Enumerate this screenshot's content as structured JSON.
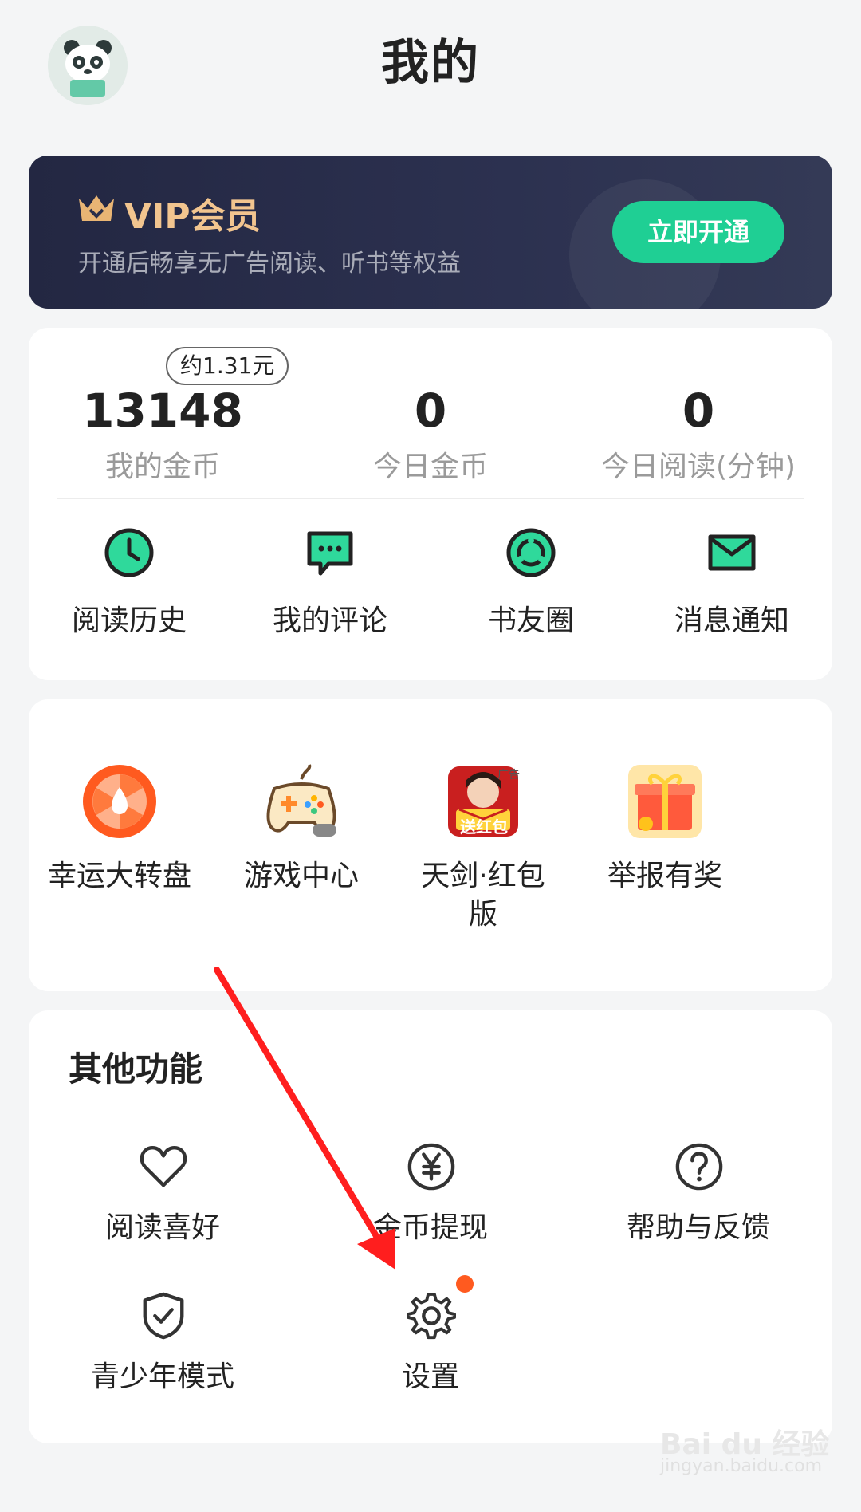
{
  "header": {
    "title": "我的"
  },
  "vip": {
    "title": "VIP会员",
    "description": "开通后畅享无广告阅读、听书等权益",
    "button": "立即开通"
  },
  "stats": [
    {
      "value": "13148",
      "label": "我的金币",
      "badge": "约1.31元"
    },
    {
      "value": "0",
      "label": "今日金币"
    },
    {
      "value": "0",
      "label": "今日阅读(分钟)"
    }
  ],
  "quick_actions": [
    {
      "label": "阅读历史",
      "icon": "clock-icon"
    },
    {
      "label": "我的评论",
      "icon": "comment-icon"
    },
    {
      "label": "书友圈",
      "icon": "circle-icon"
    },
    {
      "label": "消息通知",
      "icon": "mail-icon"
    }
  ],
  "promos": [
    {
      "label": "幸运大转盘",
      "icon": "lucky-wheel-icon"
    },
    {
      "label": "游戏中心",
      "icon": "gamepad-icon"
    },
    {
      "label_line1": "天剑·红包",
      "label_line2": "版",
      "icon": "game-ad-icon",
      "ad_tag": "广告",
      "ad_text": "送红包"
    },
    {
      "label": "举报有奖",
      "icon": "gift-icon"
    }
  ],
  "other": {
    "title": "其他功能",
    "items": [
      {
        "label": "阅读喜好",
        "icon": "heart-icon"
      },
      {
        "label": "金币提现",
        "icon": "yen-icon"
      },
      {
        "label": "帮助与反馈",
        "icon": "help-icon"
      },
      {
        "label": "青少年模式",
        "icon": "shield-check-icon"
      },
      {
        "label": "设置",
        "icon": "gear-icon"
      }
    ]
  },
  "watermark": {
    "brand": "Bai du 经验",
    "url": "jingyan.baidu.com"
  },
  "colors": {
    "accent": "#1fcf94",
    "vip_gold": "#f2c58f",
    "notify_dot": "#ff5a1f"
  }
}
